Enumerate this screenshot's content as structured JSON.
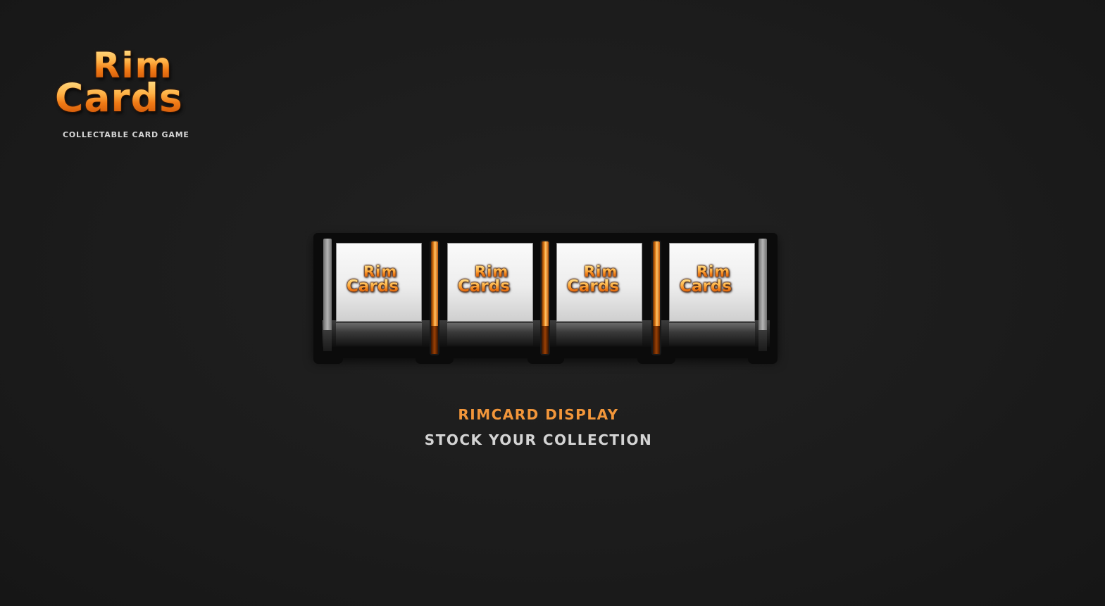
{
  "logo": {
    "word_top": "Rim",
    "word_bottom": "Cards",
    "tagline": "COLLECTABLE CARD GAME"
  },
  "display": {
    "slots": [
      {
        "top": "Rim",
        "bottom": "Cards"
      },
      {
        "top": "Rim",
        "bottom": "Cards"
      },
      {
        "top": "Rim",
        "bottom": "Cards"
      },
      {
        "top": "Rim",
        "bottom": "Cards"
      }
    ]
  },
  "caption": {
    "title": "RIMCARD DISPLAY",
    "subtitle": "STOCK YOUR COLLECTION"
  },
  "colors": {
    "background": "#1c1c1c",
    "accent_orange": "#f2963a",
    "caption_text": "#d4d4d4",
    "frame": "#0b0b0b"
  }
}
